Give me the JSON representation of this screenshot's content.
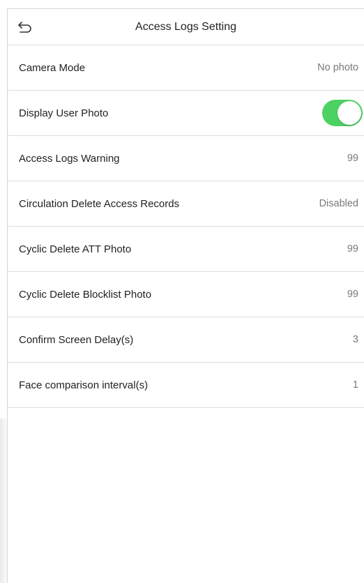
{
  "header": {
    "title": "Access Logs Setting",
    "back_icon": "back-arrow-icon"
  },
  "settings": [
    {
      "label": "Camera Mode",
      "value": "No photo",
      "type": "value"
    },
    {
      "label": "Display User Photo",
      "value": "",
      "type": "toggle",
      "toggle_on": true
    },
    {
      "label": "Access Logs Warning",
      "value": "99",
      "type": "value"
    },
    {
      "label": "Circulation Delete Access Records",
      "value": "Disabled",
      "type": "value"
    },
    {
      "label": "Cyclic Delete ATT Photo",
      "value": "99",
      "type": "value"
    },
    {
      "label": "Cyclic Delete Blocklist Photo",
      "value": "99",
      "type": "value"
    },
    {
      "label": "Confirm Screen Delay(s)",
      "value": "3",
      "type": "value"
    },
    {
      "label": "Face comparison interval(s)",
      "value": "1",
      "type": "value"
    }
  ],
  "colors": {
    "toggle_on": "#4cd262",
    "divider": "#dcdcdc",
    "value_text": "#7a7a7a"
  }
}
